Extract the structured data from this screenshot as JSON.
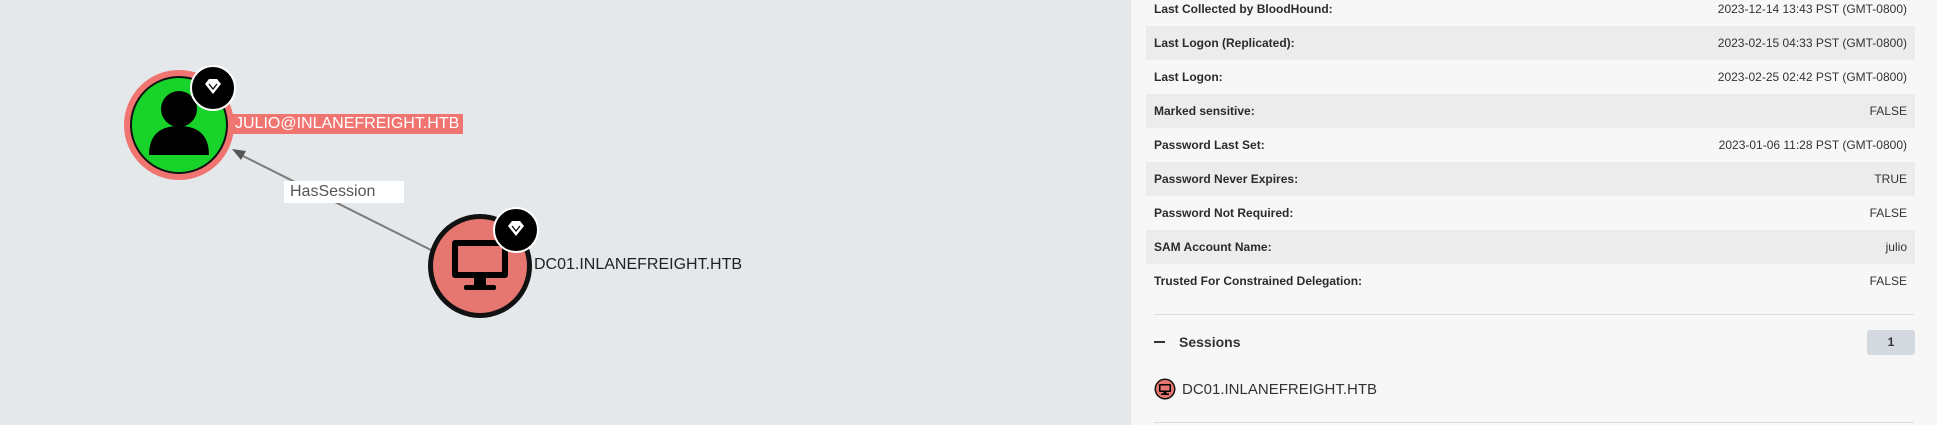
{
  "graph": {
    "user_node_label": "JULIO@INLANEFREIGHT.HTB",
    "computer_node_label": "DC01.INLANEFREIGHT.HTB",
    "edge_label": "HasSession",
    "colors": {
      "user_fill": "#18d42a",
      "highlight_ring": "#f07570",
      "computer_fill": "#e67670",
      "badge": "#000000"
    }
  },
  "properties": [
    {
      "key": "Last Collected by BloodHound:",
      "value": "2023-12-14 13:43 PST (GMT-0800)"
    },
    {
      "key": "Last Logon (Replicated):",
      "value": "2023-02-15 04:33 PST (GMT-0800)"
    },
    {
      "key": "Last Logon:",
      "value": "2023-02-25 02:42 PST (GMT-0800)"
    },
    {
      "key": "Marked sensitive:",
      "value": "FALSE"
    },
    {
      "key": "Password Last Set:",
      "value": "2023-01-06 11:28 PST (GMT-0800)"
    },
    {
      "key": "Password Never Expires:",
      "value": "TRUE"
    },
    {
      "key": "Password Not Required:",
      "value": "FALSE"
    },
    {
      "key": "SAM Account Name:",
      "value": "julio"
    },
    {
      "key": "Trusted For Constrained Delegation:",
      "value": "FALSE"
    }
  ],
  "sessions": {
    "title": "Sessions",
    "count": "1",
    "items": [
      {
        "label": "DC01.INLANEFREIGHT.HTB",
        "icon": "computer-icon"
      }
    ]
  }
}
